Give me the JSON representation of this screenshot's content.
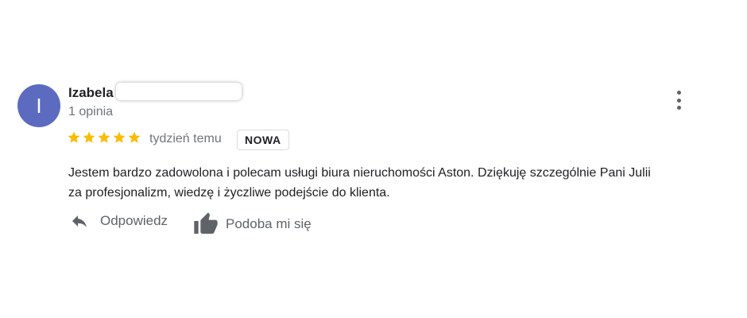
{
  "review": {
    "avatar_initial": "I",
    "author_name": "Izabela",
    "review_count": "1 opinia",
    "rating": 5,
    "max_rating": 5,
    "time_ago": "tydzień temu",
    "badge": "NOWA",
    "text_lines": [
      "Jestem bardzo zadowolona i polecam usługi biura nieruchomości Aston. Dziękuję szczególnie Pani Julii",
      "za profesjonalizm, wiedzę i życzliwe podejście do klienta."
    ]
  },
  "actions": {
    "reply_label": "Odpowiedz",
    "like_label": "Podoba mi się"
  },
  "icons": {
    "more": "more-vert-icon",
    "star": "star-icon",
    "reply": "reply-icon",
    "like": "thumb-up-icon"
  },
  "colors": {
    "avatar_bg": "#5c6bc0",
    "star": "#fbbc04",
    "text": "#202124",
    "secondary": "#70757a"
  }
}
